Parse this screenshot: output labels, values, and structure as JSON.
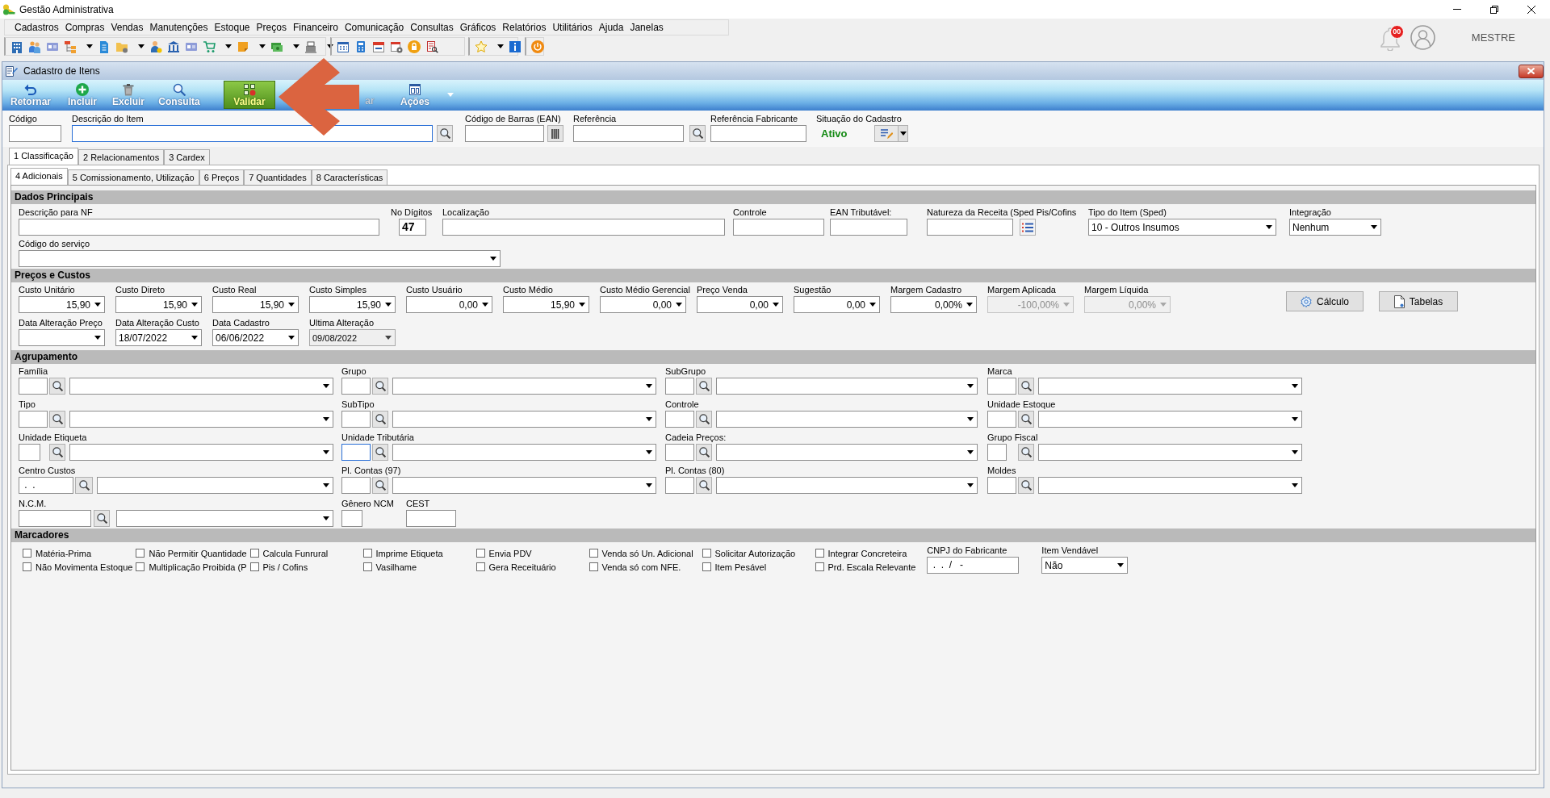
{
  "window": {
    "title": "Gestão Administrativa"
  },
  "menu_bar": [
    "Cadastros",
    "Compras",
    "Vendas",
    "Manutenções",
    "Estoque",
    "Preços",
    "Financeiro",
    "Comunicação",
    "Consultas",
    "Gráficos",
    "Relatórios",
    "Utilitários",
    "Ajuda",
    "Janelas"
  ],
  "toolbar": [
    {
      "items": [
        {
          "kind": "building",
          "menu": false
        },
        {
          "kind": "people",
          "menu": false
        },
        {
          "kind": "card",
          "menu": false
        },
        {
          "kind": "org_chart",
          "menu": true
        },
        {
          "kind": "document",
          "menu": false
        },
        {
          "kind": "folder",
          "menu": true
        },
        {
          "kind": "person",
          "menu": false
        },
        {
          "kind": "bank",
          "menu": false
        },
        {
          "kind": "card",
          "menu": false
        },
        {
          "kind": "cart",
          "menu": true
        },
        {
          "kind": "box",
          "menu": true
        },
        {
          "kind": "money",
          "menu": true
        },
        {
          "kind": "register",
          "menu": true
        }
      ]
    },
    {
      "items": [
        {
          "kind": "calendar_grid",
          "menu": false
        },
        {
          "kind": "calculator",
          "menu": false
        },
        {
          "kind": "calendar",
          "menu": false
        },
        {
          "kind": "calendar_gear",
          "menu": false
        },
        {
          "kind": "padlock",
          "menu": false
        },
        {
          "kind": "report",
          "menu": false
        }
      ]
    },
    {
      "items": [
        {
          "kind": "star",
          "menu": true
        },
        {
          "kind": "info",
          "menu": false
        }
      ]
    },
    {
      "items": [
        {
          "kind": "power",
          "menu": false
        }
      ]
    }
  ],
  "notifications": {
    "count": "00"
  },
  "user": {
    "name": "MESTRE"
  },
  "form_window": {
    "title": "Cadastro de Itens",
    "ribbon": [
      {
        "kind": "back",
        "label": "Retornar",
        "selected": false,
        "disabled": false,
        "menu": false
      },
      {
        "kind": "add",
        "label": "Incluir",
        "selected": false,
        "disabled": false,
        "menu": false
      },
      {
        "kind": "delete",
        "label": "Excluir",
        "selected": false,
        "disabled": false,
        "menu": false
      },
      {
        "kind": "search",
        "label": "Consulta",
        "selected": false,
        "disabled": false,
        "menu": false
      },
      {
        "kind": "validate",
        "label": "Validar",
        "selected": true,
        "disabled": false,
        "menu": false
      },
      {
        "kind": "partial",
        "label": "ar",
        "selected": false,
        "disabled": true,
        "menu": false
      },
      {
        "kind": "actions",
        "label": "Ações",
        "selected": false,
        "disabled": false,
        "menu": true
      }
    ],
    "header_fields": [
      {
        "kind": "text",
        "label": "Código",
        "highlighted": false
      },
      {
        "kind": "search",
        "label": "Descrição do Item",
        "highlighted": true
      },
      {
        "kind": "bars",
        "label": "Código de Barras (EAN)",
        "highlighted": false
      },
      {
        "kind": "search",
        "label": "Referência",
        "highlighted": false
      },
      {
        "kind": "text",
        "label": "Referência Fabricante",
        "highlighted": false
      },
      {
        "kind": "status",
        "label": "Situação do Cadastro",
        "value": "Ativo"
      }
    ],
    "tabs": [
      {
        "label": "1 Classificação",
        "selected": true
      },
      {
        "label": "2 Relacionamentos",
        "selected": false
      },
      {
        "label": "3 Cardex",
        "selected": false
      }
    ],
    "subtabs": [
      {
        "label": "4 Adicionais",
        "selected": true
      },
      {
        "label": "5 Comissionamento, Utilização",
        "selected": false
      },
      {
        "label": "6 Preços",
        "selected": false
      },
      {
        "label": "7 Quantidades",
        "selected": false
      },
      {
        "label": "8 Características",
        "selected": false
      }
    ],
    "sections": [
      {
        "kind": "fields",
        "title": "Dados Principais",
        "rows": [
          [
            {
              "kind": "text",
              "label": "Descrição para NF"
            },
            {
              "kind": "digits",
              "label": "No Dígitos",
              "value": "47"
            },
            {
              "kind": "text",
              "label": "Localização"
            },
            {
              "kind": "text",
              "label": "Controle"
            },
            {
              "kind": "text",
              "label": "EAN Tributável:"
            },
            {
              "kind": "text_list",
              "label": "Natureza da Receita (Sped Pis/Cofins"
            },
            {
              "kind": "select",
              "label": "Tipo do Item (Sped)",
              "value": "10 - Outros Insumos"
            },
            {
              "kind": "select",
              "label": "Integração",
              "value": "Nenhum"
            }
          ],
          [
            {
              "kind": "select",
              "label": "Código do serviço"
            }
          ]
        ]
      },
      {
        "kind": "fields",
        "title": "Preços e Custos",
        "rows": [
          [
            {
              "kind": "number",
              "label": "Custo Unitário",
              "value": "15,90",
              "disabled": false
            },
            {
              "kind": "number",
              "label": "Custo Direto",
              "value": "15,90",
              "disabled": false
            },
            {
              "kind": "number",
              "label": "Custo Real",
              "value": "15,90",
              "disabled": false
            },
            {
              "kind": "number",
              "label": "Custo Simples",
              "value": "15,90",
              "disabled": false
            },
            {
              "kind": "number",
              "label": "Custo Usuário",
              "value": "0,00",
              "disabled": false
            },
            {
              "kind": "number",
              "label": "Custo Médio",
              "value": "15,90",
              "disabled": false
            },
            {
              "kind": "number",
              "label": "Custo Médio Gerencial",
              "value": "0,00",
              "disabled": false
            },
            {
              "kind": "number",
              "label": "Preço Venda",
              "value": "0,00",
              "disabled": false
            },
            {
              "kind": "number",
              "label": "Sugestão",
              "value": "0,00",
              "disabled": false
            },
            {
              "kind": "number",
              "label": "Margem Cadastro",
              "value": "0,00%",
              "disabled": false
            },
            {
              "kind": "number",
              "label": "Margem Aplicada",
              "value": "-100,00%",
              "disabled": true
            },
            {
              "kind": "number",
              "label": "Margem Líquida",
              "value": "0,00%",
              "disabled": true
            }
          ],
          [
            {
              "kind": "date",
              "label": "Data Alteração Preço",
              "disabled": false
            },
            {
              "kind": "date",
              "label": "Data Alteração Custo",
              "value": "18/07/2022",
              "disabled": false
            },
            {
              "kind": "date",
              "label": "Data Cadastro",
              "value": "06/06/2022",
              "disabled": false
            },
            {
              "kind": "date",
              "label": "Ultima Alteração",
              "value": "09/08/2022",
              "disabled": true
            }
          ]
        ],
        "buttons": [
          {
            "kind": "gear",
            "label": "Cálculo"
          },
          {
            "kind": "document",
            "label": "Tabelas"
          }
        ]
      },
      {
        "kind": "fields",
        "title": "Agrupamento",
        "rows": [
          [
            {
              "kind": "lookup",
              "label": "Família",
              "highlighted": false
            },
            {
              "kind": "lookup",
              "label": "Grupo",
              "highlighted": false
            },
            {
              "kind": "lookup",
              "label": "SubGrupo",
              "highlighted": false
            },
            {
              "kind": "lookup",
              "label": "Marca",
              "highlighted": false
            }
          ],
          [
            {
              "kind": "lookup",
              "label": "Tipo",
              "highlighted": false
            },
            {
              "kind": "lookup",
              "label": "SubTipo",
              "highlighted": false
            },
            {
              "kind": "lookup",
              "label": "Controle",
              "highlighted": false
            },
            {
              "kind": "lookup",
              "label": "Unidade Estoque",
              "highlighted": false
            }
          ],
          [
            {
              "kind": "lookup",
              "label": "Unidade Etiqueta",
              "highlighted": false
            },
            {
              "kind": "lookup",
              "label": "Unidade Tributária",
              "highlighted": true
            },
            {
              "kind": "lookup",
              "label": "Cadeia Preços:",
              "highlighted": false
            },
            {
              "kind": "lookup",
              "label": "Grupo Fiscal",
              "highlighted": false
            }
          ],
          [
            {
              "kind": "lookup",
              "label": "Centro Custos",
              "value": " .  .",
              "highlighted": false
            },
            {
              "kind": "lookup",
              "label": "Pl. Contas (97)",
              "highlighted": false
            },
            {
              "kind": "lookup",
              "label": "Pl. Contas (80)",
              "highlighted": false
            },
            {
              "kind": "lookup",
              "label": "Moldes",
              "highlighted": false
            }
          ],
          [
            {
              "kind": "lookup",
              "label": "N.C.M.",
              "highlighted": false
            },
            {
              "kind": "text",
              "label": "Gênero NCM"
            },
            {
              "kind": "text",
              "label": "CEST"
            }
          ]
        ]
      },
      {
        "kind": "markers",
        "title": "Marcadores",
        "columns": [
          [
            {
              "label": "Matéria-Prima",
              "checked": false
            },
            {
              "label": "Não Movimenta Estoque",
              "checked": false
            }
          ],
          [
            {
              "label": "Não Permitir Quantidade",
              "checked": false
            },
            {
              "label": "Multiplicação Proibida (P",
              "checked": false
            }
          ],
          [
            {
              "label": "Calcula Funrural",
              "checked": false
            },
            {
              "label": "Pis / Cofins",
              "checked": false
            }
          ],
          [
            {
              "label": "Imprime Etiqueta",
              "checked": false
            },
            {
              "label": "Vasilhame",
              "checked": false
            }
          ],
          [
            {
              "label": "Envia PDV",
              "checked": false
            },
            {
              "label": "Gera Receituário",
              "checked": false
            }
          ],
          [
            {
              "label": "Venda só Un. Adicional",
              "checked": false
            },
            {
              "label": "Venda só com NFE.",
              "checked": false
            }
          ],
          [
            {
              "label": "Solicitar Autorização",
              "checked": false
            },
            {
              "label": "Item Pesável",
              "checked": false
            }
          ],
          [
            {
              "label": "Integrar Concreteira",
              "checked": false
            },
            {
              "label": "Prd. Escala Relevante",
              "checked": false
            }
          ]
        ],
        "fields": [
          {
            "kind": "text",
            "label": "CNPJ do Fabricante",
            "value": " .  .  /   -"
          },
          {
            "kind": "select",
            "label": "Item Vendável",
            "value": "Não"
          }
        ]
      }
    ]
  },
  "overlays": [
    {
      "kind": "arrow"
    }
  ]
}
